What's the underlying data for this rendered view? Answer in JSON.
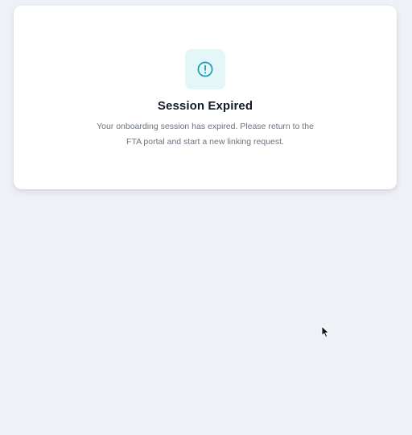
{
  "dialog": {
    "icon": "alert-circle-icon",
    "title": "Session Expired",
    "message": "Your onboarding session has expired. Please return to the FTA portal and start a new linking request."
  },
  "colors": {
    "page_background": "#eef1f5",
    "card_background": "#ffffff",
    "accent": "#0e9aa7",
    "icon_tile_background": "#e3f6f8",
    "title_text": "#121a2b",
    "body_text": "#6b7280"
  },
  "cursor": {
    "icon": "mouse-pointer-icon"
  }
}
